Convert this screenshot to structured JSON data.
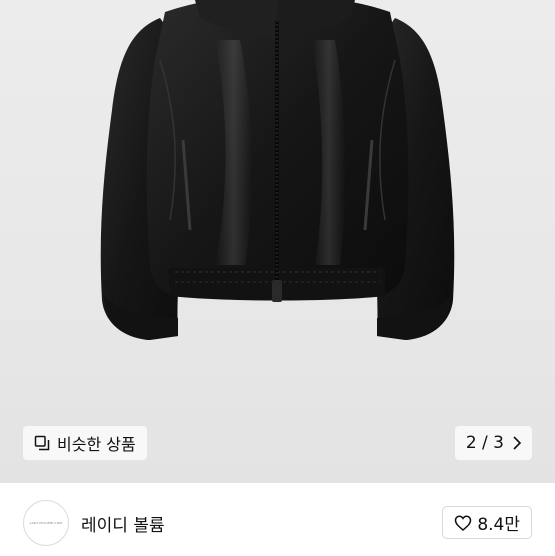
{
  "product": {
    "image_alt": "black leather jacket",
    "similar_button": {
      "label": "비슷한 상품",
      "icon": "copy-icon"
    },
    "pager": {
      "text": "2 / 3",
      "icon": "chevron-right-icon"
    }
  },
  "seller": {
    "name": "레이디 볼륨",
    "avatar_text": "LADYVOLUME.COM"
  },
  "like": {
    "count": "8.4만",
    "icon": "heart-outline-icon"
  },
  "colors": {
    "background": "#e8e8e8",
    "jacket": "#1a1a1a",
    "text": "#111111",
    "border": "#d9d9d9"
  }
}
